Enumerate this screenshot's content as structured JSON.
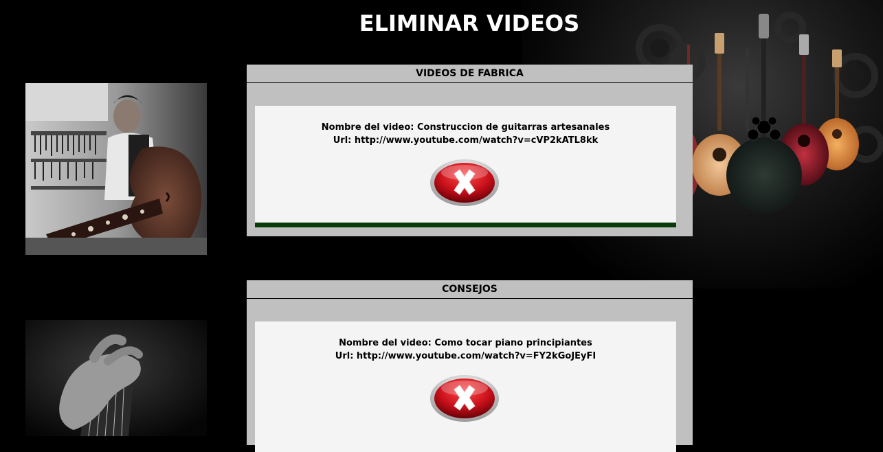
{
  "page": {
    "title": "ELIMINAR VIDEOS"
  },
  "sections": [
    {
      "header": "VIDEOS DE FABRICA",
      "video": {
        "name_label": "Nombre del video:",
        "name_value": "Construccion de guitarras artesanales",
        "url_label": "Url:",
        "url_value": "http://www.youtube.com/watch?v=cVP2kATL8kk"
      },
      "delete_icon": "delete-x-icon"
    },
    {
      "header": "CONSEJOS",
      "video": {
        "name_label": "Nombre del video:",
        "name_value": "Como tocar piano principiantes",
        "url_label": "Url:",
        "url_value": "http://www.youtube.com/watch?v=FY2kGoJEyFI"
      },
      "delete_icon": "delete-x-icon"
    }
  ],
  "colors": {
    "background": "#000000",
    "panel": "#c0c0c0",
    "card": "#f4f4f4",
    "card_bar": "#0a3a0a",
    "delete_red": "#c8101a"
  }
}
